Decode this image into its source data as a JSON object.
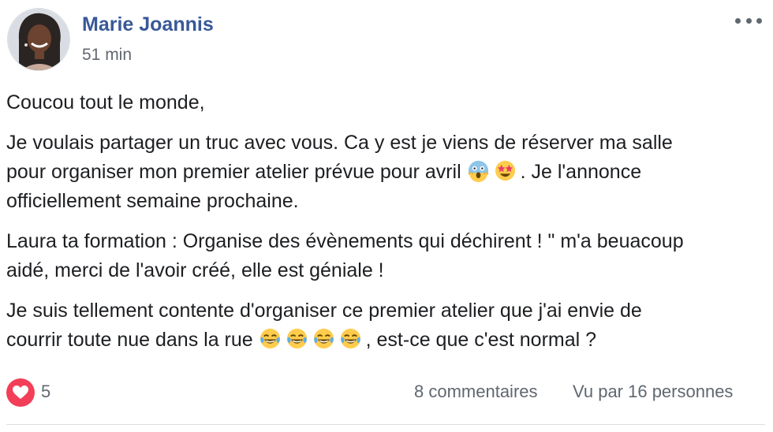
{
  "post": {
    "author": "Marie Joannis",
    "time": "51 min",
    "paragraphs": {
      "p1": "Coucou tout le monde,",
      "p2_line1": "Je voulais partager un truc avec vous. Ca y est je viens de réserver ma salle",
      "p2_line2_before": "pour organiser mon premier atelier prévue pour avril ",
      "p2_line2_after": ". Je l'annonce",
      "p2_line3": "officiellement semaine prochaine.",
      "p3_line1": "Laura ta formation : Organise des évènements qui déchirent ! \" m'a beuacoup",
      "p3_line2": "aidé, merci de l'avoir créé, elle est géniale !",
      "p4_line1": "Je suis tellement contente d'organiser ce premier atelier que j'ai envie de",
      "p4_line2_before": "courrir toute nue dans la rue ",
      "p4_line2_after": ", est-ce que c'est normal ?"
    },
    "emojis": {
      "scream": "face-screaming-in-fear",
      "star_struck": "star-struck",
      "laughing": "face-with-tears-of-joy"
    }
  },
  "footer": {
    "reaction_icon": "heart-icon",
    "reaction_count": "5",
    "comments": "8 commentaires",
    "seen_by": "Vu par 16 personnes"
  },
  "colors": {
    "author_link": "#385898",
    "meta_text": "#616770",
    "reaction_love": "#f33e58"
  }
}
